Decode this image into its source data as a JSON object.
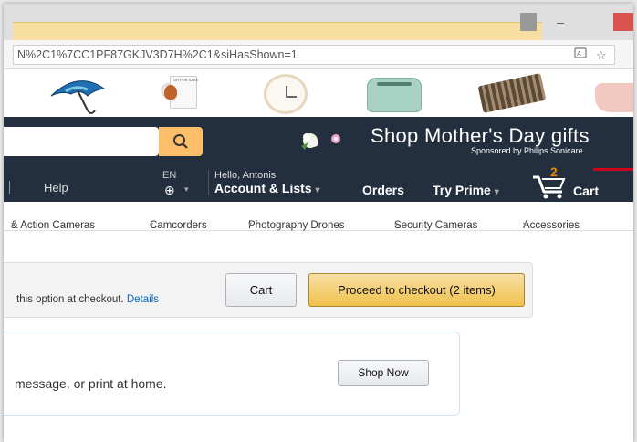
{
  "browser": {
    "url": "N%2C1%7CC1PF87GKJV3D7H%2C1&siHasShown=1",
    "window_controls": [
      "—",
      "–",
      "□",
      "✕"
    ],
    "translate_icon": "translate-icon",
    "star_icon": "star-icon"
  },
  "banner": {
    "mug_text": "OH FOR SAKE"
  },
  "header": {
    "search_icon": "search-icon",
    "promo_title": "Shop Mother's Day gifts",
    "promo_sub": "Sponsored by Philips Sonicare"
  },
  "nav": {
    "help": "Help",
    "lang": "EN",
    "globe": "⊕",
    "caret": "▾",
    "hello": "Hello, Antonis",
    "account": "Account & Lists",
    "orders": "Orders",
    "prime": "Try Prime",
    "cart_count": "2",
    "cart": "Cart"
  },
  "subnav": {
    "items": [
      "& Action Cameras",
      "Camcorders",
      "Photography Drones",
      "Security Cameras",
      "Accessories"
    ]
  },
  "cartbox": {
    "message": "this option at checkout.",
    "details_link": "Details",
    "cart_button": "Cart",
    "checkout_button": "Proceed to checkout (2 items)"
  },
  "giftbox": {
    "message": "message, or print at home.",
    "shop_now": "Shop Now"
  },
  "colors": {
    "header_bg": "#232f3e",
    "search_button": "#febd69",
    "checkout_button": "#f0c14b",
    "cart_count": "#f08804",
    "link": "#0066c0"
  }
}
